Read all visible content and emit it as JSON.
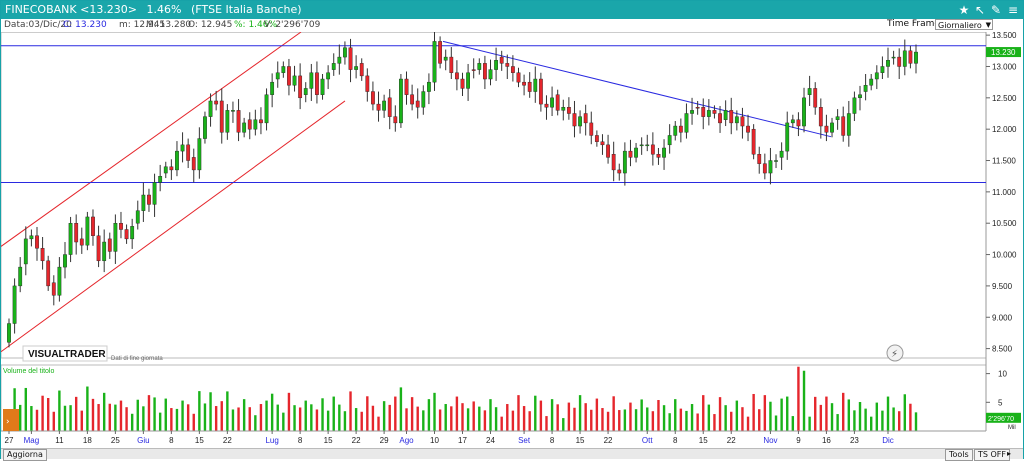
{
  "titlebar": {
    "symbol": "FINECOBANK <13.230>",
    "change": "1.46%",
    "index": "(FTSE Italia Banche)"
  },
  "infobar": {
    "date": "Data:03/Dic/20",
    "close": "C: 13.230",
    "low": "m: 12.945",
    "high": "M: 13.280",
    "open": "O: 12.945",
    "pct": "%: 1.46%",
    "volume": "V: 2'296'709",
    "timeframe_label": "Time Frame",
    "timeframe_value": "Giornaliero"
  },
  "brand": "VISUALTRADER",
  "brand_sub": "Dati di fine giornata",
  "volume_panel_label": "Volume del titolo",
  "bottom": {
    "refresh": "Aggiorna",
    "tools": "Tools",
    "ts": "TS OFF"
  },
  "colors": {
    "up": "#19b219",
    "down": "#e5262c",
    "channel": "#e5262c",
    "trend": "#2a2ae0",
    "support": "#2a2ae0",
    "accent": "#1aa6aa"
  },
  "chart_data": {
    "type": "candlestick",
    "title": "FINECOBANK",
    "y_axis_price": {
      "min": 8.35,
      "max": 13.55,
      "ticks": [
        "8.500",
        "9.000",
        "9.500",
        "10.000",
        "10.500",
        "11.000",
        "11.500",
        "12.000",
        "12.500",
        "13.000",
        "13.500"
      ]
    },
    "last_price_label": "13.230",
    "last_volume_label": "2'296'70",
    "volume_axis_ticks": [
      "5",
      "10"
    ],
    "volume_unit": "Mil",
    "x_ticks": [
      {
        "label": "27",
        "i": 0
      },
      {
        "label": "Mag",
        "i": 4,
        "month": true
      },
      {
        "label": "11",
        "i": 9
      },
      {
        "label": "18",
        "i": 14
      },
      {
        "label": "25",
        "i": 19
      },
      {
        "label": "Giu",
        "i": 24,
        "month": true
      },
      {
        "label": "8",
        "i": 29
      },
      {
        "label": "15",
        "i": 34
      },
      {
        "label": "22",
        "i": 39
      },
      {
        "label": "Lug",
        "i": 47,
        "month": true
      },
      {
        "label": "8",
        "i": 52
      },
      {
        "label": "15",
        "i": 57
      },
      {
        "label": "22",
        "i": 62
      },
      {
        "label": "29",
        "i": 67
      },
      {
        "label": "Ago",
        "i": 71,
        "month": true
      },
      {
        "label": "10",
        "i": 76
      },
      {
        "label": "17",
        "i": 81
      },
      {
        "label": "24",
        "i": 86
      },
      {
        "label": "Set",
        "i": 92,
        "month": true
      },
      {
        "label": "8",
        "i": 97
      },
      {
        "label": "15",
        "i": 102
      },
      {
        "label": "22",
        "i": 107
      },
      {
        "label": "Ott",
        "i": 114,
        "month": true
      },
      {
        "label": "8",
        "i": 119
      },
      {
        "label": "15",
        "i": 124
      },
      {
        "label": "22",
        "i": 129
      },
      {
        "label": "Nov",
        "i": 136,
        "month": true
      },
      {
        "label": "9",
        "i": 141
      },
      {
        "label": "16",
        "i": 146
      },
      {
        "label": "23",
        "i": 151
      },
      {
        "label": "Dic",
        "i": 157,
        "month": true
      }
    ],
    "close": [
      8.9,
      9.5,
      9.8,
      10.25,
      10.3,
      10.1,
      9.9,
      9.5,
      9.35,
      9.8,
      10.0,
      10.5,
      10.2,
      10.15,
      10.6,
      10.3,
      9.9,
      10.2,
      10.05,
      10.5,
      10.4,
      10.25,
      10.45,
      10.7,
      10.95,
      10.8,
      11.15,
      11.25,
      11.4,
      11.35,
      11.65,
      11.75,
      11.5,
      11.35,
      11.85,
      12.2,
      12.45,
      12.4,
      11.95,
      12.3,
      12.3,
      11.95,
      12.1,
      12.0,
      12.15,
      12.1,
      12.55,
      12.75,
      12.9,
      13.0,
      12.7,
      12.85,
      12.5,
      12.65,
      12.9,
      12.55,
      12.8,
      12.9,
      13.05,
      13.15,
      13.3,
      12.95,
      13.0,
      12.85,
      12.6,
      12.4,
      12.3,
      12.45,
      12.2,
      12.1,
      12.8,
      12.55,
      12.4,
      12.35,
      12.6,
      12.75,
      13.4,
      13.05,
      13.15,
      12.9,
      12.8,
      12.65,
      12.9,
      12.95,
      13.05,
      12.8,
      12.95,
      13.1,
      13.05,
      13.0,
      12.9,
      12.75,
      12.7,
      12.6,
      12.8,
      12.4,
      12.35,
      12.5,
      12.3,
      12.35,
      12.25,
      12.05,
      12.2,
      12.1,
      11.9,
      11.8,
      11.75,
      11.55,
      11.35,
      11.3,
      11.65,
      11.55,
      11.7,
      11.75,
      11.75,
      11.6,
      11.55,
      11.7,
      11.9,
      12.05,
      11.95,
      12.25,
      12.3,
      12.35,
      12.2,
      12.3,
      12.25,
      12.1,
      12.3,
      12.1,
      12.2,
      12.05,
      11.95,
      11.6,
      11.45,
      11.3,
      11.5,
      11.5,
      11.65,
      12.1,
      12.15,
      12.05,
      12.5,
      12.65,
      12.35,
      12.05,
      11.95,
      12.1,
      12.2,
      11.9,
      12.25,
      12.5,
      12.55,
      12.7,
      12.8,
      12.9,
      13.0,
      13.1,
      13.15,
      13.0,
      13.25,
      13.05,
      13.23
    ]
  }
}
